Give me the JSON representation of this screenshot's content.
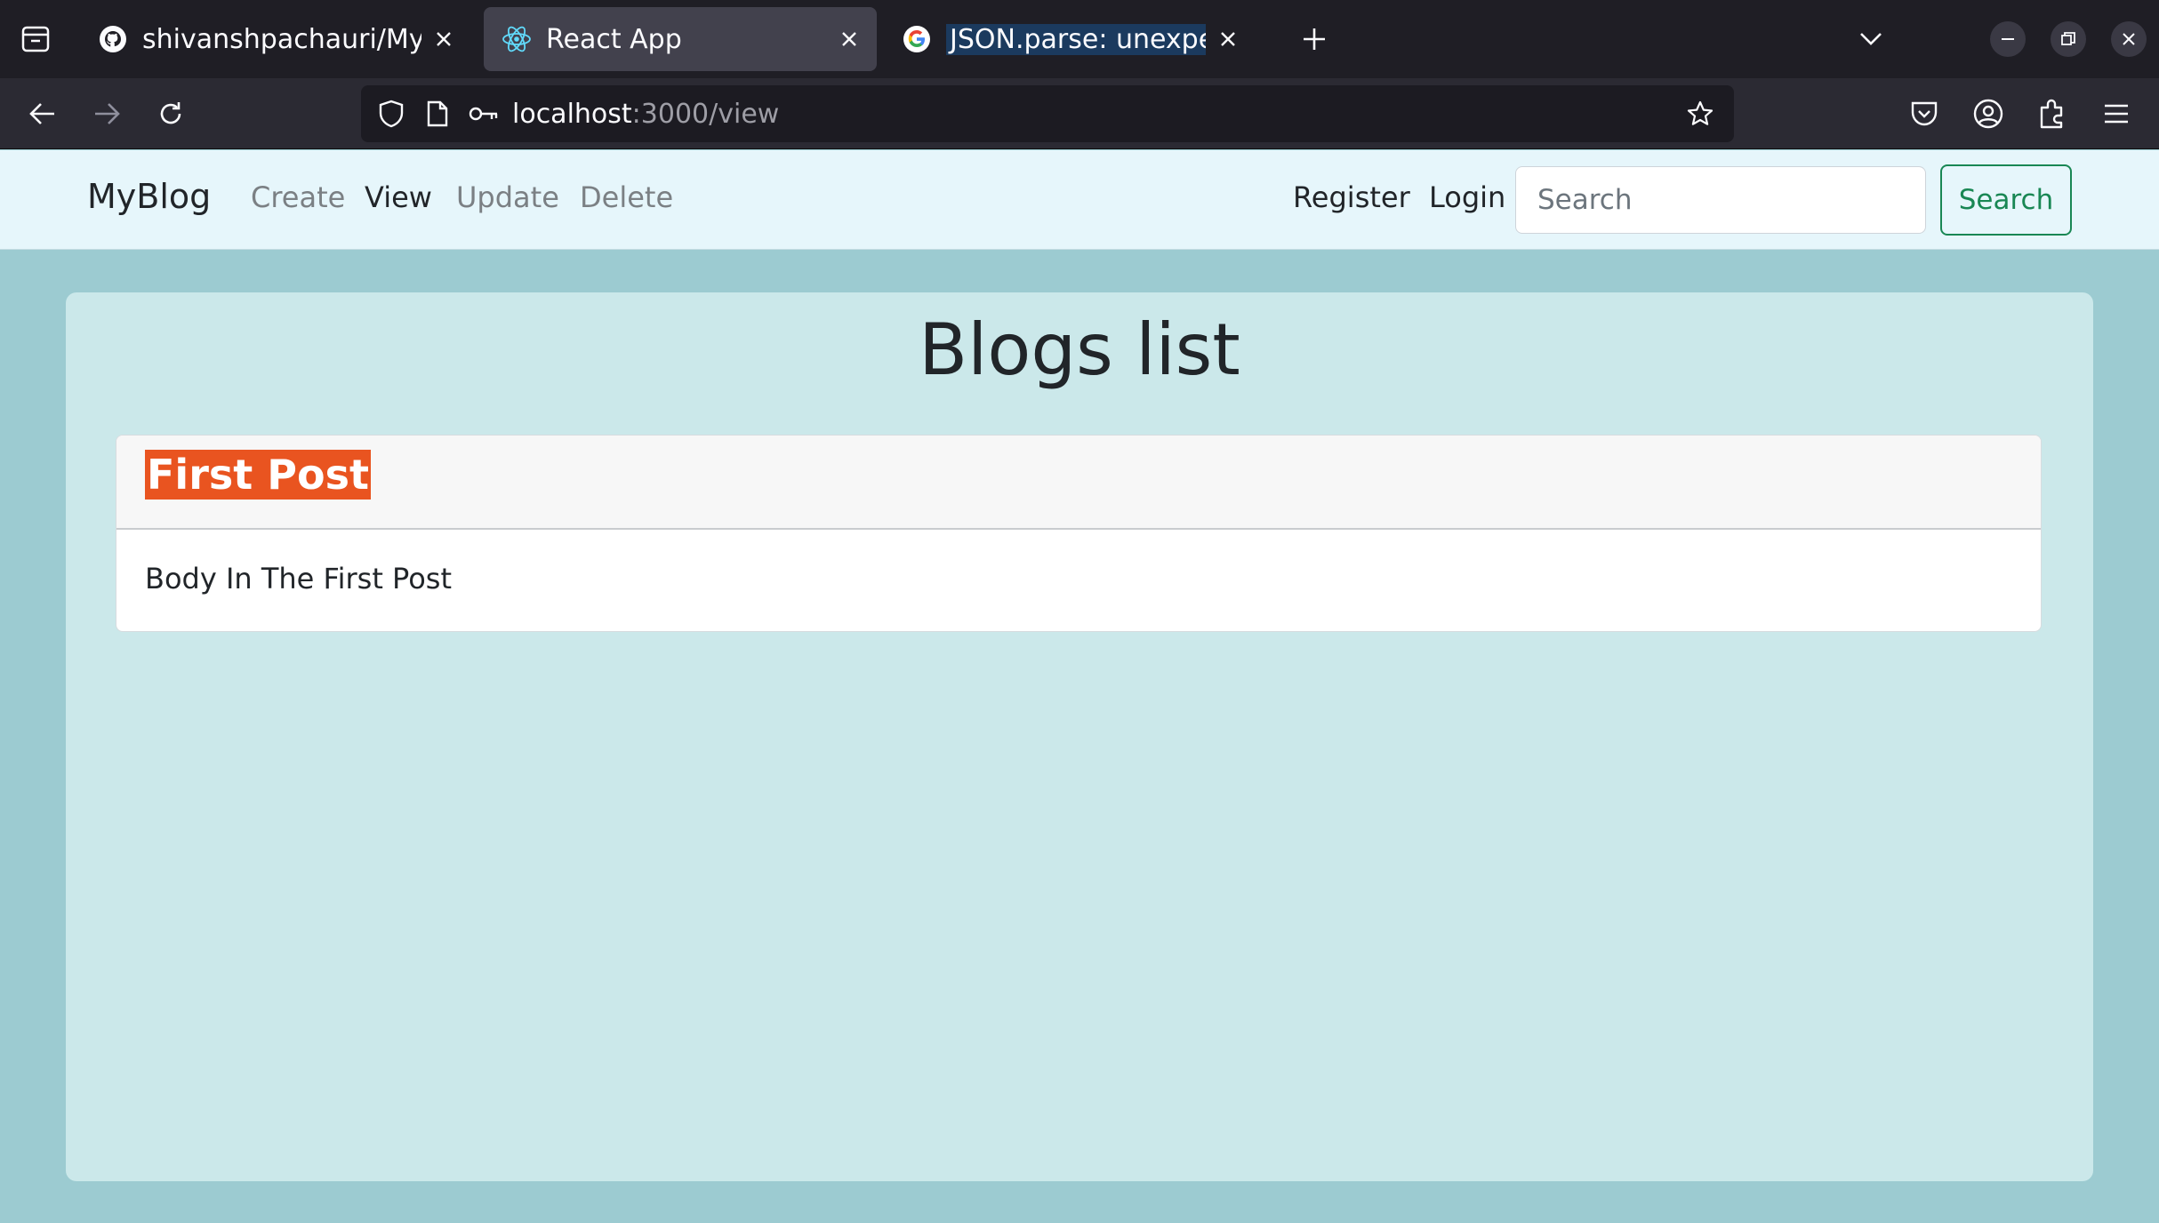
{
  "browser": {
    "tabs": [
      {
        "title": "shivanshpachauri/MyBlog",
        "favicon": "github-icon",
        "active": false
      },
      {
        "title": "React App",
        "favicon": "react-icon",
        "active": true
      },
      {
        "title": "JSON.parse: unexpected",
        "favicon": "google-icon",
        "active": false
      }
    ],
    "url_host": "localhost",
    "url_path": ":3000/view"
  },
  "site": {
    "brand": "MyBlog",
    "nav": {
      "create": "Create",
      "view": "View",
      "update": "Update",
      "delete": "Delete",
      "register": "Register",
      "login": "Login"
    },
    "search": {
      "placeholder": "Search",
      "button": "Search"
    }
  },
  "main": {
    "title": "Blogs list",
    "posts": [
      {
        "title": "First Post",
        "body": "Body In The First Post"
      }
    ]
  },
  "colors": {
    "page_bg": "#9ccbd1",
    "container_bg": "#cbe8ea",
    "navbar_bg": "#e6f6fb",
    "highlight": "#e95420",
    "success": "#198754"
  }
}
